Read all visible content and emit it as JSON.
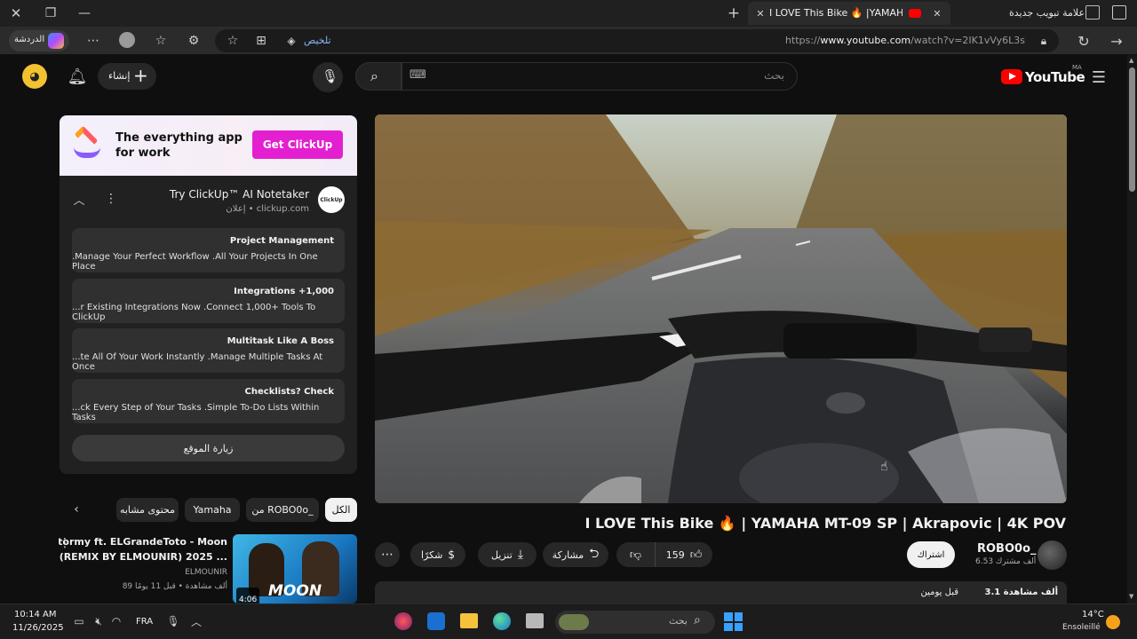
{
  "browser": {
    "tabs": [
      {
        "title": "I LOVE This Bike 🔥 |YAMAHA MT",
        "active": true
      },
      {
        "title": "علامة تبويب جديدة",
        "active": false
      }
    ],
    "url_prefix": "https://",
    "url_host": "www.youtube.com",
    "url_path": "/watch?v=2IK1vVy6L3s",
    "summarize_label": "تلخيص",
    "chat_label": "الدردشة"
  },
  "youtube": {
    "logo_text": "YouTube",
    "region": "MA",
    "search_placeholder": "بحث",
    "create_label": "إنشاء"
  },
  "ad": {
    "banner_line1": "The everything app",
    "banner_line2": "for work",
    "banner_cta": "Get ClickUp",
    "title": "Try ClickUp™ AI Notetaker",
    "sponsor": "إعلان • clickup.com",
    "logo_text": "ClickUp",
    "items": [
      {
        "title": "Project Management",
        "desc": ".Manage Your Perfect Workflow .All Your Projects In One Place"
      },
      {
        "title": "Integrations +1,000",
        "desc": "...r Existing Integrations Now .Connect 1,000+ Tools To ClickUp"
      },
      {
        "title": "Multitask Like A Boss",
        "desc": "...te All Of Your Work Instantly .Manage Multiple Tasks At Once"
      },
      {
        "title": "Checklists? Check",
        "desc": "...ck Every Step of Your Tasks .Simple To-Do Lists Within Tasks"
      }
    ],
    "visit_label": "زيارة الموقع"
  },
  "chips": [
    "الكل",
    "من ROBO0o_",
    "Yamaha",
    "محتوى مشابه"
  ],
  "video": {
    "title": "I LOVE This Bike 🔥  | YAMAHA MT-09 SP | Akrapovic | 4K POV",
    "channel": "ROBO0o_",
    "subscribers": "6.53 ألف مشترك",
    "subscribe_label": "اشتراك",
    "likes": "159",
    "share_label": "مشاركة",
    "download_label": "تنزيل",
    "thanks_label": "شكرًا",
    "views": "3.1 ألف مشاهدة",
    "posted": "قبل يومين"
  },
  "related": {
    "title_line1": "Stormy ft. ELGrandeToto - Moon",
    "title_line2": "(REMIX BY ELMOUNIR) 2025 ...",
    "channel": "ELMOUNIR",
    "meta": "89 ألف مشاهدة • قبل 11 يومًا",
    "duration": "4:06",
    "thumb_text": "MOON"
  },
  "taskbar": {
    "time": "10:14 AM",
    "date": "11/26/2025",
    "lang": "FRA",
    "search_placeholder": "بحث",
    "weather_temp": "14°C",
    "weather_desc": "Ensoleillé"
  }
}
